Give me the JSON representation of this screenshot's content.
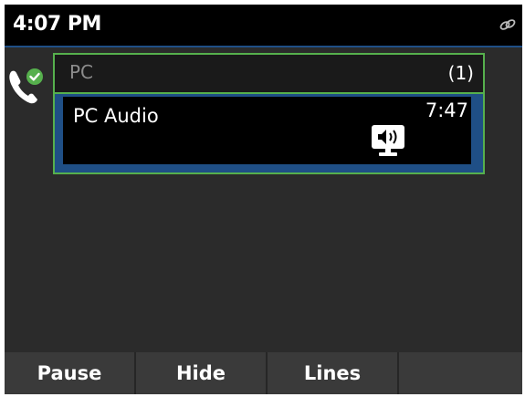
{
  "status_bar": {
    "time": "4:07 PM",
    "right_icon": "link-icon"
  },
  "line": {
    "icon": "phone-handset-with-check-icon",
    "status_color": "#56b04d"
  },
  "call": {
    "header_name": "PC",
    "header_count": "(1)",
    "title": "PC Audio",
    "duration": "7:47",
    "audio_icon": "speaker-display-icon",
    "highlight_color": "#56b04d",
    "selection_color": "#1f4f86"
  },
  "softkeys": [
    {
      "label": "Pause"
    },
    {
      "label": "Hide"
    },
    {
      "label": "Lines"
    },
    {
      "label": ""
    }
  ]
}
